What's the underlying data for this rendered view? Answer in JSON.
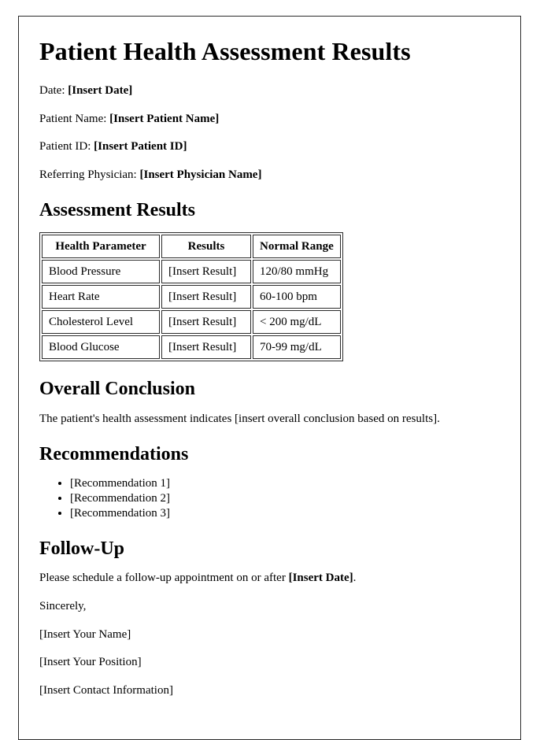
{
  "document": {
    "title": "Patient Health Assessment Results",
    "border_color": "#2b2b2b",
    "background_color": "#ffffff",
    "text_color": "#000000"
  },
  "meta": [
    {
      "label": "Date: ",
      "value": "[Insert Date]"
    },
    {
      "label": "Patient Name: ",
      "value": "[Insert Patient Name]"
    },
    {
      "label": "Patient ID: ",
      "value": "[Insert Patient ID]"
    },
    {
      "label": "Referring Physician: ",
      "value": "[Insert Physician Name]"
    }
  ],
  "assessment": {
    "heading": "Assessment Results",
    "columns": [
      "Health Parameter",
      "Results",
      "Normal Range"
    ],
    "rows": [
      [
        "Blood Pressure",
        "[Insert Result]",
        "120/80 mmHg"
      ],
      [
        "Heart Rate",
        "[Insert Result]",
        "60-100 bpm"
      ],
      [
        "Cholesterol Level",
        "[Insert Result]",
        "< 200 mg/dL"
      ],
      [
        "Blood Glucose",
        "[Insert Result]",
        "70-99 mg/dL"
      ]
    ]
  },
  "conclusion": {
    "heading": "Overall Conclusion",
    "text": "The patient's health assessment indicates [insert overall conclusion based on results]."
  },
  "recommendations": {
    "heading": "Recommendations",
    "items": [
      "[Recommendation 1]",
      "[Recommendation 2]",
      "[Recommendation 3]"
    ]
  },
  "followup": {
    "heading": "Follow-Up",
    "text_before": "Please schedule a follow-up appointment on or after ",
    "date_placeholder": "[Insert Date]",
    "text_after": ".",
    "closing": "Sincerely,",
    "signature": [
      "[Insert Your Name]",
      "[Insert Your Position]",
      "[Insert Contact Information]"
    ]
  }
}
